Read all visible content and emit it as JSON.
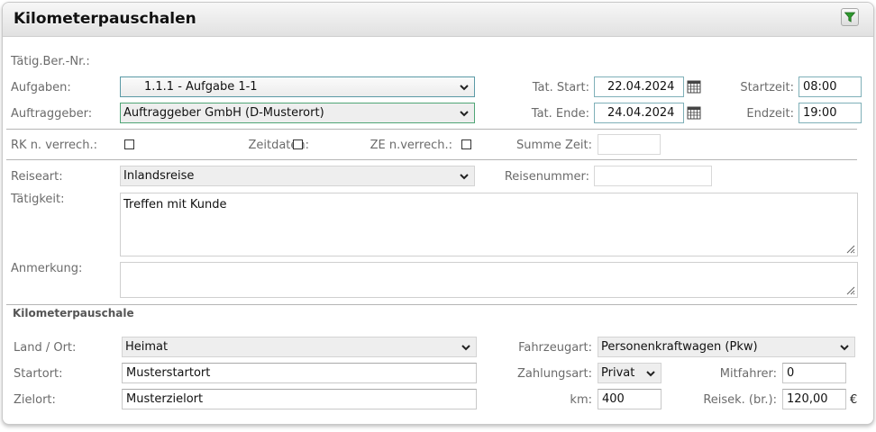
{
  "header": {
    "title": "Kilometerpauschalen"
  },
  "labels": {
    "taetig_ber_nr": "Tätig.Ber.-Nr.:",
    "aufgaben": "Aufgaben:",
    "auftraggeber": "Auftraggeber:",
    "tat_start": "Tat. Start:",
    "tat_ende": "Tat. Ende:",
    "startzeit": "Startzeit:",
    "endzeit": "Endzeit:",
    "rk_verrech": "RK n. verrech.:",
    "zeitdaten": "Zeitdaten:",
    "ze_verrech": "ZE n.verrech.:",
    "summe_zeit": "Summe Zeit:",
    "reiseart": "Reiseart:",
    "reisenummer": "Reisenummer:",
    "taetigkeit": "Tätigkeit:",
    "anmerkung": "Anmerkung:",
    "land_ort": "Land / Ort:",
    "fahrzeugart": "Fahrzeugart:",
    "startort": "Startort:",
    "zahlungsart": "Zahlungsart:",
    "mitfahrer": "Mitfahrer:",
    "zielort": "Zielort:",
    "km": "km:",
    "reisek": "Reisek. (br.):"
  },
  "section": {
    "kilometerpauschale": "Kilometerpauschale"
  },
  "values": {
    "aufgaben": "1.1.1 - Aufgabe 1-1",
    "auftraggeber": "Auftraggeber GmbH (D-Musterort)",
    "tat_start": "22.04.2024",
    "tat_ende": "24.04.2024",
    "startzeit": "08:00",
    "endzeit": "19:00",
    "summe_zeit": "",
    "reiseart": "Inlandsreise",
    "reisenummer": "",
    "taetigkeit": "Treffen mit Kunde",
    "anmerkung": "",
    "land_ort": "Heimat",
    "fahrzeugart": "Personenkraftwagen (Pkw)",
    "startort": "Musterstartort",
    "zahlungsart": "Privat",
    "mitfahrer": "0",
    "zielort": "Musterzielort",
    "km": "400",
    "reisek": "120,00",
    "currency": "€"
  },
  "checkboxes": {
    "rk_verrech": false,
    "zeitdaten": false,
    "ze_verrech": false
  },
  "icons": {
    "filter": "funnel-filter-icon",
    "calendar": "calendar-icon",
    "dropdown": "chevron-down-icon",
    "resize": "resize-grip-icon"
  },
  "colors": {
    "filter_green": "#2e9a2e",
    "focus_border": "#5b9aa6",
    "label": "#6b6b6b"
  }
}
